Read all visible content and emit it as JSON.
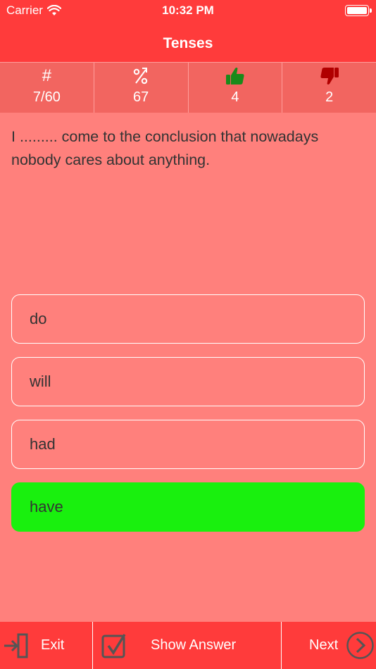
{
  "status_bar": {
    "carrier": "Carrier",
    "time": "10:32 PM"
  },
  "nav": {
    "title": "Tenses"
  },
  "stats": [
    {
      "icon": "hash-icon",
      "symbol": "#",
      "value": "7/60"
    },
    {
      "icon": "percent-icon",
      "symbol": "%",
      "value": "67"
    },
    {
      "icon": "thumbs-up-icon",
      "symbol": "",
      "value": "4",
      "color": "#1a8a1a"
    },
    {
      "icon": "thumbs-down-icon",
      "symbol": "",
      "value": "2",
      "color": "#b00000"
    }
  ],
  "question": {
    "text": "I ......... come to the conclusion that nowadays nobody cares about anything."
  },
  "answers": [
    {
      "label": "do",
      "correct": false
    },
    {
      "label": "will",
      "correct": false
    },
    {
      "label": "had",
      "correct": false
    },
    {
      "label": "have",
      "correct": true
    }
  ],
  "bottom_bar": {
    "exit_label": "Exit",
    "show_answer_label": "Show Answer",
    "next_label": "Next"
  },
  "colors": {
    "primary": "#ff3b3b",
    "background": "#ff807c",
    "stats_bg": "#f26560",
    "correct": "#19f00e",
    "icon_gray": "#666666"
  }
}
